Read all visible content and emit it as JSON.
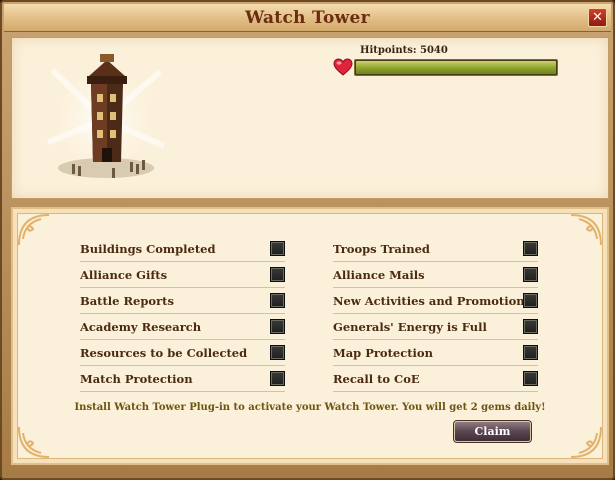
{
  "window": {
    "title": "Watch Tower",
    "close_label": "✕"
  },
  "hitpoints": {
    "label": "Hitpoints: 5040",
    "fill_fraction": 1.0
  },
  "options_left": [
    {
      "label": "Buildings Completed",
      "checked": false
    },
    {
      "label": "Alliance Gifts",
      "checked": false
    },
    {
      "label": "Battle Reports",
      "checked": false
    },
    {
      "label": "Academy Research",
      "checked": false
    },
    {
      "label": "Resources to be Collected",
      "checked": false
    },
    {
      "label": "Match Protection",
      "checked": false
    }
  ],
  "options_right": [
    {
      "label": "Troops Trained",
      "checked": false
    },
    {
      "label": "Alliance Mails",
      "checked": false
    },
    {
      "label": "New Activities and Promotions",
      "checked": false
    },
    {
      "label": "Generals' Energy is Full",
      "checked": false
    },
    {
      "label": "Map Protection",
      "checked": false
    },
    {
      "label": "Recall to CoE",
      "checked": false
    }
  ],
  "note": "Install Watch Tower Plug-in to activate your Watch Tower. You will get 2 gems daily!",
  "claim_label": "Claim",
  "colors": {
    "title": "#6b2d10",
    "hp_bar": "#8ea22c",
    "note": "#6a5410"
  },
  "icons": {
    "heart": "heart-icon",
    "close": "close-icon",
    "tower": "watch-tower-icon"
  }
}
